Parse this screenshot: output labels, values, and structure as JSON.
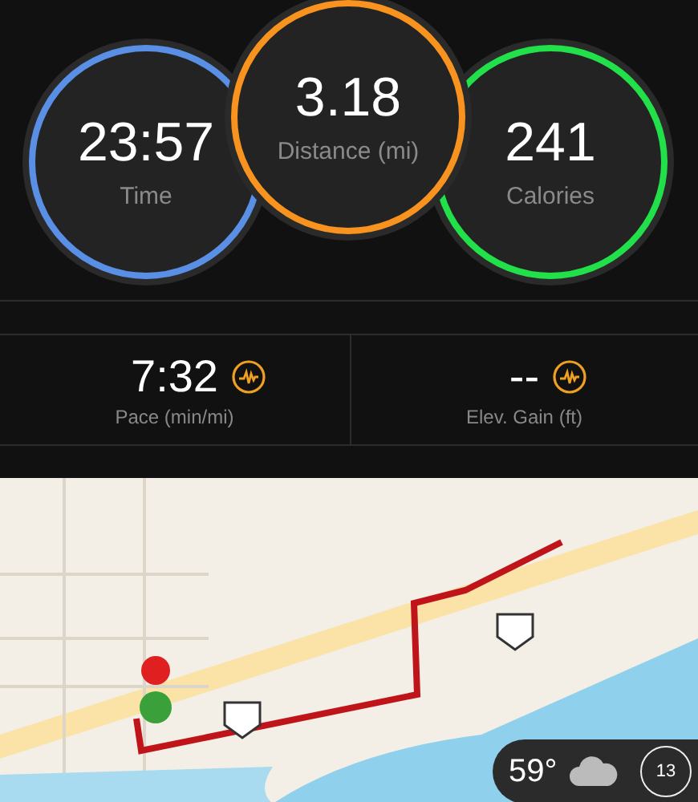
{
  "rings": [
    {
      "value": "23:57",
      "label": "Time",
      "color": "#5a8fe6"
    },
    {
      "value": "3.18",
      "label": "Distance (mi)",
      "color": "#f7931e"
    },
    {
      "value": "241",
      "label": "Calories",
      "color": "#22e04a"
    }
  ],
  "stats": [
    {
      "value": "7:32",
      "label": "Pace (min/mi)"
    },
    {
      "value": "--",
      "label": "Elev. Gain (ft)"
    }
  ],
  "map": {
    "kind": "picture",
    "weather": {
      "temperature": "59°",
      "air_quality": "13"
    }
  }
}
